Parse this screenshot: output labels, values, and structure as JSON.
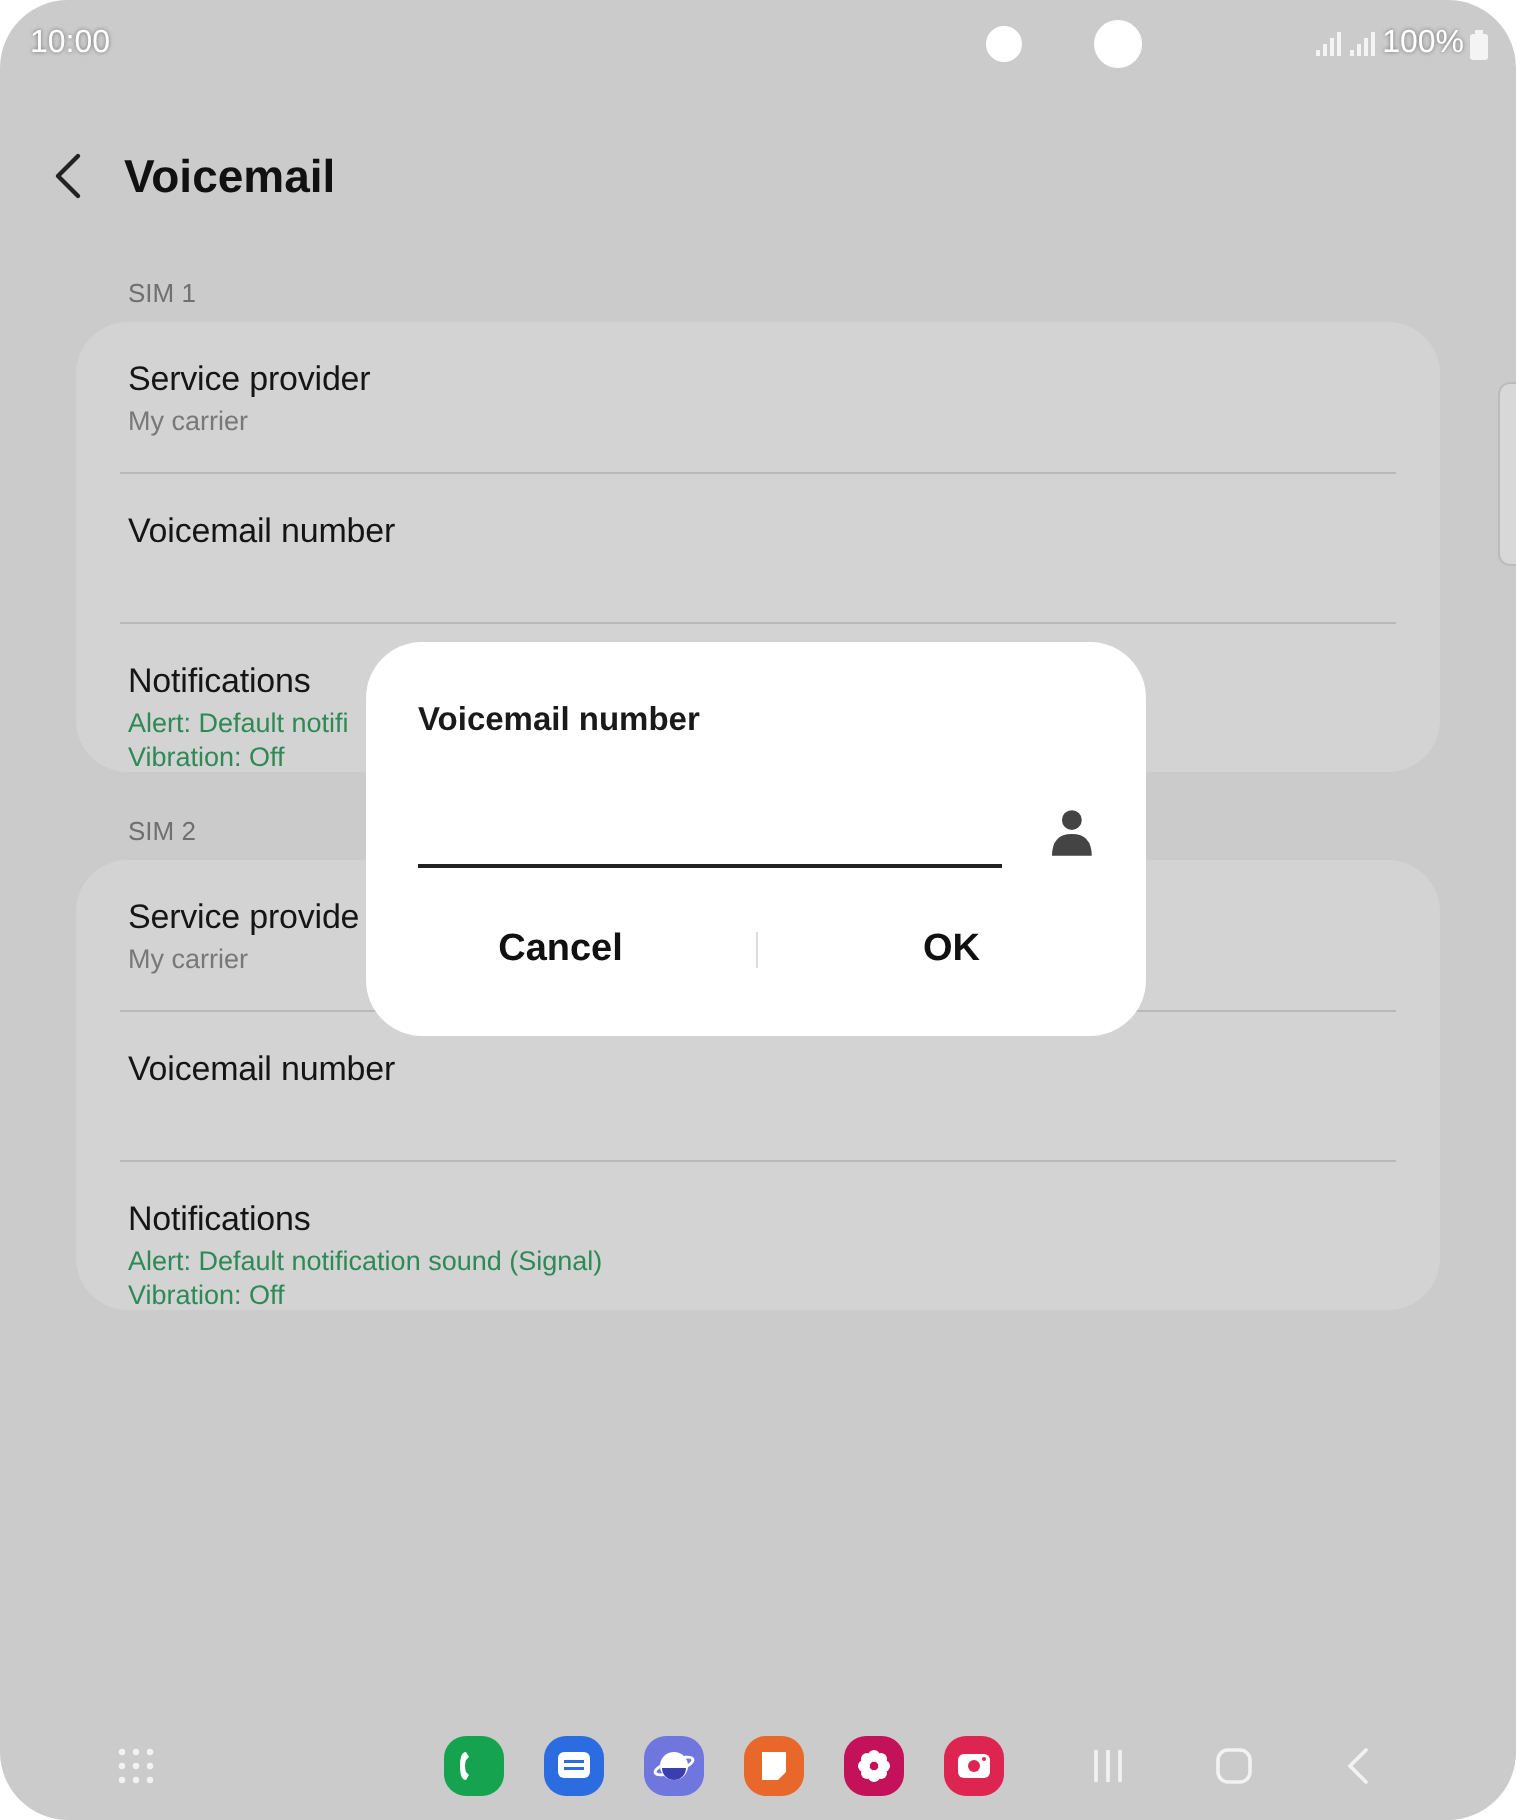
{
  "status_bar": {
    "time": "10:00",
    "battery": "100%"
  },
  "header": {
    "title": "Voicemail"
  },
  "sections": [
    {
      "label": "SIM 1",
      "items": [
        {
          "title": "Service provider",
          "subtitle": "My carrier"
        },
        {
          "title": "Voicemail number"
        },
        {
          "title": "Notifications",
          "details": [
            "Alert: Default notifi",
            "Vibration: Off"
          ]
        }
      ]
    },
    {
      "label": "SIM 2",
      "items": [
        {
          "title": "Service provide",
          "subtitle": "My carrier"
        },
        {
          "title": "Voicemail number"
        },
        {
          "title": "Notifications",
          "details": [
            "Alert: Default notification sound (Signal)",
            "Vibration: Off"
          ]
        }
      ]
    }
  ],
  "dialog": {
    "title": "Voicemail number",
    "buttons": [
      "Cancel",
      "OK"
    ]
  },
  "dock": {
    "apps": [
      {
        "kind": "phone",
        "color": "#16a34f"
      },
      {
        "kind": "messages",
        "color": "#2b6de0"
      },
      {
        "kind": "browser",
        "color": "#6f76de"
      },
      {
        "kind": "notes",
        "color": "#e8682c"
      },
      {
        "kind": "gallery",
        "color": "#c4125a"
      },
      {
        "kind": "camera",
        "color": "#de2450"
      }
    ]
  }
}
